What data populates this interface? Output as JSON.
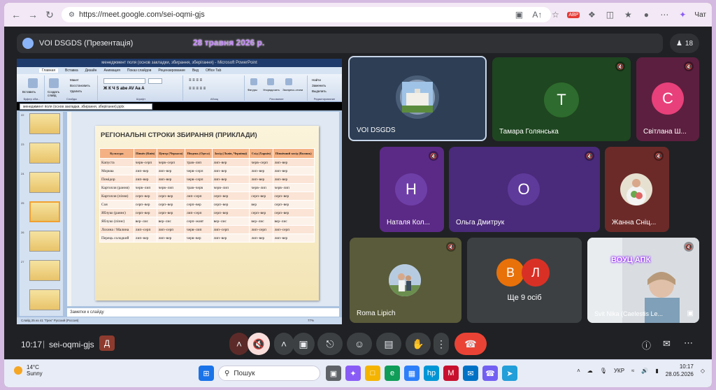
{
  "browser": {
    "url": "https://meet.google.com/sei-oqmi-gjs",
    "chat_label": "Чат",
    "adblock_label": "ABP"
  },
  "meet": {
    "presentation_title": "VOI DSGDS (Презентація)",
    "date_overlay": "28 травня 2026 р.",
    "participant_count": "18",
    "time": "10:17",
    "meeting_code": "sei-oqmi-gjs"
  },
  "ppt": {
    "window_title": "менеджмент поля (основ закладки, збирання, зберігання) - Microsoft PowerPoint",
    "tabs": [
      "Главная",
      "Вставка",
      "Дизайн",
      "Анимация",
      "Показ слайдов",
      "Рецензирование",
      "Вид",
      "Office Tab"
    ],
    "active_tab": "Главная",
    "group_names": [
      "Буфер обм...",
      "Слайды",
      "Шрифт",
      "Абзац",
      "Рисование",
      "Редактирование"
    ],
    "ribbon_labels": {
      "paste": "Вставить",
      "new_slide": "Создать слайд",
      "layout": "Макет",
      "reset": "Восстановить",
      "delete": "Удалить",
      "shapes": "Фигуры",
      "arrange": "Упорядочить",
      "quick_styles": "Экспресс-стили",
      "find": "Найти",
      "replace": "Заменить",
      "select": "Выделить"
    },
    "doc_tab": "менеджмент поля (основ закладки, збирання, зберігання).pptx",
    "thumb_numbers": [
      "22",
      "23",
      "24",
      "25",
      "26",
      "27"
    ],
    "notes_placeholder": "Заметки к слайду",
    "status": "Слайд 25 из 41   \"Грек\"   Русский (Россия)",
    "zoom": "77%"
  },
  "slide": {
    "title": "РЕГІОНАЛЬНІ СТРОКИ ЗБИРАННЯ (ПРИКЛАДИ)",
    "headers": [
      "Культура",
      "Північ (Київ)",
      "Центр (Черкаси)",
      "Південь (Одеса)",
      "Захід (Львів, Чернівці)",
      "Схід (Харків)",
      "Північний захід (Волинь)"
    ],
    "rows": [
      [
        "Капуста",
        "черв–серп",
        "черв–серп",
        "трав–лип",
        "лип–вер",
        "черв–серп",
        "лип–вер"
      ],
      [
        "Морква",
        "лип–вер",
        "лип–вер",
        "черв–серп",
        "лип–вер",
        "лип–вер",
        "лип–вер"
      ],
      [
        "Помідор",
        "лип–вер",
        "лип–вер",
        "черв–серп",
        "лип–вер",
        "лип–вер",
        "лип–вер"
      ],
      [
        "Картопля (рання)",
        "черв–лип",
        "черв–лип",
        "трав–черв",
        "черв–лип",
        "черв–лип",
        "черв–лип"
      ],
      [
        "Картопля (пізня)",
        "серп–вер",
        "серп–вер",
        "лип–серп",
        "серп–вер",
        "серп–вер",
        "серп–вер"
      ],
      [
        "Соя",
        "серп–вер",
        "серп–вер",
        "серп–вер",
        "серп–вер",
        "вер",
        "серп–вер"
      ],
      [
        "Яблуко (раннє)",
        "серп–вер",
        "серп–вер",
        "лип–серп",
        "серп–вер",
        "серп–вер",
        "серп–вер"
      ],
      [
        "Яблуко (пізнє)",
        "вер–лис",
        "вер–лис",
        "серп–жовт",
        "вер–лис",
        "вер–лис",
        "вер–лис"
      ],
      [
        "Лохина / Малина",
        "лип–серп",
        "лип–серп",
        "черв–лип",
        "лип–серп",
        "лип–серп",
        "лип–серп"
      ],
      [
        "Перець солодкий",
        "лип–вер",
        "лип–вер",
        "черв–вер",
        "лип–вер",
        "лип–вер",
        "лип–вер"
      ]
    ]
  },
  "tiles": {
    "voi": {
      "name": "VOI DSGDS"
    },
    "tamara": {
      "name": "Тамара Голянська",
      "initial": "Т"
    },
    "svitlana": {
      "name": "Світлана Ш...",
      "initial": "С"
    },
    "natalia": {
      "name": "Наталя Кол...",
      "initial": "Н"
    },
    "olha": {
      "name": "Ольга Дмитрук",
      "initial": "О"
    },
    "zhanna": {
      "name": "Жанна Сніц..."
    },
    "roma": {
      "name": "Roma Lipich"
    },
    "more": {
      "label": "Ще 9 осіб",
      "initial_1": "В",
      "initial_2": "Л"
    },
    "svit": {
      "name": "Svit Nika (Caelestis Le...",
      "overlay": "ВОУЦ АПК"
    }
  },
  "colors": {
    "tamara_bg": "#1e4620",
    "tamara_avatar": "#2e6b2e",
    "svitlana_bg": "#5c1f3f",
    "svitlana_avatar": "#e8407a",
    "natalia_bg": "#5b2a86",
    "natalia_avatar": "#6f3fa8",
    "olha_bg": "#4a2a7a",
    "olha_avatar": "#5e3a9a",
    "more_avatar_1": "#e8710a",
    "more_avatar_2": "#d93025"
  },
  "taskbar": {
    "temp": "14°C",
    "weather": "Sunny",
    "search_placeholder": "Пошук",
    "lang": "УКР",
    "clock_time": "10:17",
    "clock_date": "28.05.2026"
  }
}
